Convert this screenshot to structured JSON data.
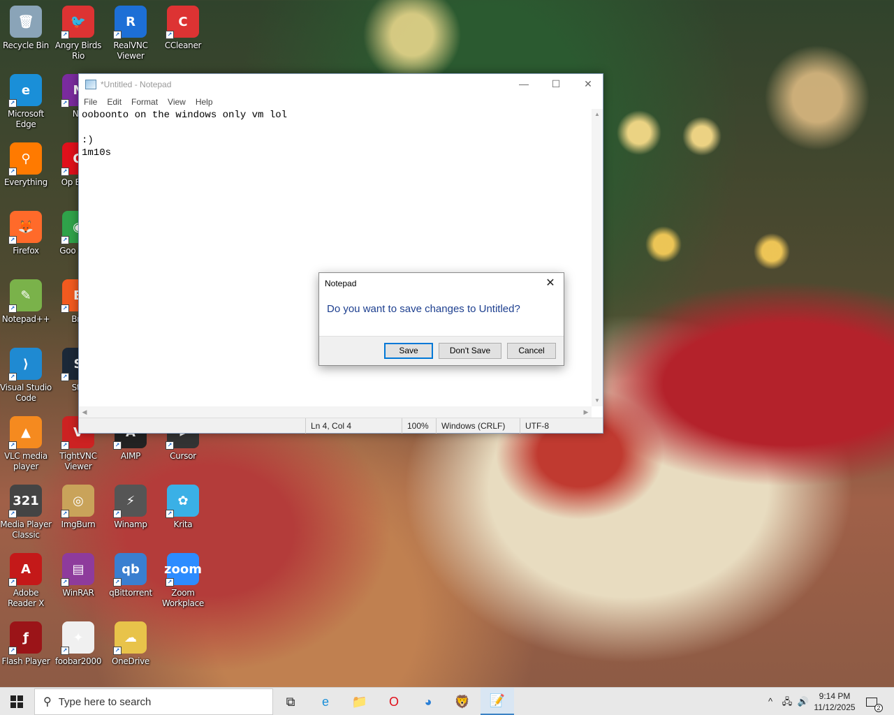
{
  "desktop": {
    "icons": [
      {
        "label": "Recycle Bin",
        "glyph": "🗑",
        "color": "#8aa4b8"
      },
      {
        "label": "Angry Birds Rio",
        "glyph": "🐦",
        "color": "#d33"
      },
      {
        "label": "RealVNC Viewer",
        "glyph": "R",
        "color": "#1d6fd6"
      },
      {
        "label": "CCleaner",
        "glyph": "C",
        "color": "#d33"
      },
      {
        "label": "Microsoft Edge",
        "glyph": "e",
        "color": "#1a8fd8"
      },
      {
        "label": "NV",
        "glyph": "N",
        "color": "#7a2b9e"
      },
      {
        "label": "Everything",
        "glyph": "⚲",
        "color": "#ff7a00"
      },
      {
        "label": "Op Brow",
        "glyph": "O",
        "color": "#e0101b"
      },
      {
        "label": "Firefox",
        "glyph": "🦊",
        "color": "#ff6a2a"
      },
      {
        "label": "Goo Chro",
        "glyph": "◉",
        "color": "#2fa34a"
      },
      {
        "label": "Notepad++",
        "glyph": "✎",
        "color": "#7ab24a"
      },
      {
        "label": "Bra",
        "glyph": "B",
        "color": "#f25a1f"
      },
      {
        "label": "Visual Studio Code",
        "glyph": "⟩",
        "color": "#1f8ad2"
      },
      {
        "label": "Ste",
        "glyph": "S",
        "color": "#1b2838"
      },
      {
        "label": "VLC media player",
        "glyph": "▲",
        "color": "#f58a1f"
      },
      {
        "label": "TightVNC Viewer",
        "glyph": "V",
        "color": "#c22"
      },
      {
        "label": "AIMP",
        "glyph": "A",
        "color": "#222"
      },
      {
        "label": "Cursor",
        "glyph": "▸",
        "color": "#333"
      },
      {
        "label": "Media Player Classic",
        "glyph": "321",
        "color": "#444"
      },
      {
        "label": "ImgBurn",
        "glyph": "◎",
        "color": "#c9a35a"
      },
      {
        "label": "Winamp",
        "glyph": "⚡",
        "color": "#555"
      },
      {
        "label": "Krita",
        "glyph": "✿",
        "color": "#3ab0e6"
      },
      {
        "label": "Adobe Reader X",
        "glyph": "A",
        "color": "#c41919"
      },
      {
        "label": "WinRAR",
        "glyph": "▤",
        "color": "#8e3b9c"
      },
      {
        "label": "qBittorrent",
        "glyph": "qb",
        "color": "#3a7fd0"
      },
      {
        "label": "Zoom Workplace",
        "glyph": "zoom",
        "color": "#2d8cff"
      },
      {
        "label": "Flash Player",
        "glyph": "ƒ",
        "color": "#9b1418"
      },
      {
        "label": "foobar2000",
        "glyph": "✦",
        "color": "#f0f0f0"
      },
      {
        "label": "OneDrive",
        "glyph": "☁",
        "color": "#e8c34a"
      }
    ]
  },
  "notepad": {
    "title": "*Untitled - Notepad",
    "minimize_glyph": "—",
    "maximize_glyph": "☐",
    "close_glyph": "✕",
    "menu": [
      "File",
      "Edit",
      "Format",
      "View",
      "Help"
    ],
    "content": "ooboonto on the windows only vm lol\n\n:)\n1m10s",
    "status": {
      "position": "Ln 4, Col 4",
      "zoom": "100%",
      "line_ending": "Windows (CRLF)",
      "encoding": "UTF-8"
    }
  },
  "dialog": {
    "title": "Notepad",
    "message": "Do you want to save changes to Untitled?",
    "close_glyph": "✕",
    "buttons": {
      "save": "Save",
      "dont_save": "Don't Save",
      "cancel": "Cancel"
    }
  },
  "taskbar": {
    "search_placeholder": "Type here to search",
    "apps": [
      {
        "name": "task-view",
        "glyph": "⧉"
      },
      {
        "name": "edge",
        "glyph": "e"
      },
      {
        "name": "file-explorer",
        "glyph": "📁"
      },
      {
        "name": "opera",
        "glyph": "O"
      },
      {
        "name": "unknown-blue",
        "glyph": "◕"
      },
      {
        "name": "brave",
        "glyph": "🦁"
      },
      {
        "name": "notepad",
        "glyph": "📝"
      }
    ],
    "tray": {
      "chevron": "^",
      "network": "🖧",
      "volume": "🔊",
      "time": "9:14 PM",
      "date": "11/12/2025",
      "notifications": "2"
    }
  }
}
